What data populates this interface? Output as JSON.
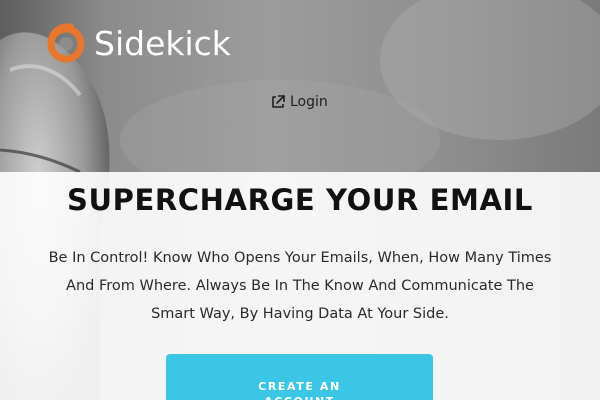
{
  "brand": {
    "name": "Sidekick",
    "logo_icon": "sidekick-ring-logo",
    "accent_color": "#e8772e"
  },
  "nav": {
    "login_label": "Login",
    "login_icon": "external-link-icon"
  },
  "hero": {
    "headline": "SUPERCHARGE YOUR EMAIL",
    "description": "Be In Control! Know Who Opens Your Emails, When, How Many Times And From Where. Always Be In The Know And Communicate The Smart Way, By Having Data At Your Side.",
    "cta_label": "CREATE AN ACCOUNT",
    "cta_color": "#3cc6e6"
  }
}
